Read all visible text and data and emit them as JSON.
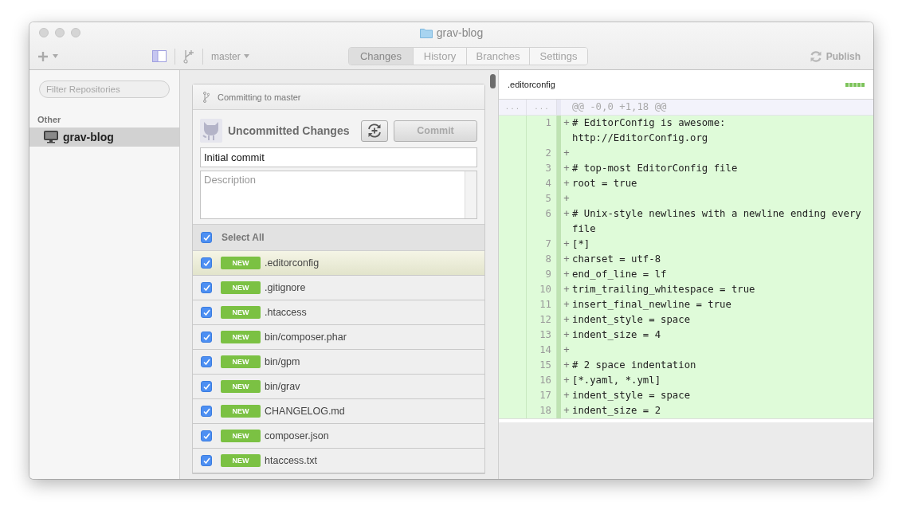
{
  "window": {
    "title": "grav-blog"
  },
  "toolbar": {
    "branch": "master",
    "tabs": [
      {
        "label": "Changes",
        "selected": true
      },
      {
        "label": "History",
        "selected": false
      },
      {
        "label": "Branches",
        "selected": false
      },
      {
        "label": "Settings",
        "selected": false
      }
    ],
    "publish": {
      "label": "Publish",
      "disabled": true
    }
  },
  "sidebar": {
    "filter": {
      "placeholder": "Filter Repositories"
    },
    "sections": [
      {
        "heading": "Other",
        "items": [
          {
            "name": "grav-blog",
            "selected": true
          }
        ]
      }
    ]
  },
  "commit": {
    "branch_label": "Committing to master",
    "title": "Uncommitted Changes",
    "summary": {
      "value": "Initial commit"
    },
    "description": {
      "placeholder": "Description"
    },
    "commit_button": {
      "label": "Commit",
      "disabled": true
    },
    "select_all": {
      "label": "Select All",
      "checked": true
    },
    "files": [
      {
        "name": ".editorconfig",
        "status": "NEW",
        "checked": true,
        "selected": true
      },
      {
        "name": ".gitignore",
        "status": "NEW",
        "checked": true,
        "selected": false
      },
      {
        "name": ".htaccess",
        "status": "NEW",
        "checked": true,
        "selected": false
      },
      {
        "name": "bin/composer.phar",
        "status": "NEW",
        "checked": true,
        "selected": false
      },
      {
        "name": "bin/gpm",
        "status": "NEW",
        "checked": true,
        "selected": false
      },
      {
        "name": "bin/grav",
        "status": "NEW",
        "checked": true,
        "selected": false
      },
      {
        "name": "CHANGELOG.md",
        "status": "NEW",
        "checked": true,
        "selected": false
      },
      {
        "name": "composer.json",
        "status": "NEW",
        "checked": true,
        "selected": false
      },
      {
        "name": "htaccess.txt",
        "status": "NEW",
        "checked": true,
        "selected": false
      }
    ]
  },
  "diff": {
    "file": ".editorconfig",
    "hunk": {
      "old": "...",
      "new": "...",
      "header": "@@ -0,0 +1,18 @@"
    },
    "lines": [
      {
        "number": "1",
        "sign": "+",
        "text": "# EditorConfig is awesome: http://EditorConfig.org"
      },
      {
        "number": "2",
        "sign": "+"
      },
      {
        "number": "3",
        "sign": "+",
        "text": "# top-most EditorConfig file"
      },
      {
        "number": "4",
        "sign": "+",
        "text": "root = true"
      },
      {
        "number": "5",
        "sign": "+"
      },
      {
        "number": "6",
        "sign": "+",
        "text": "# Unix-style newlines with a newline ending every file"
      },
      {
        "number": "7",
        "sign": "+",
        "text": "[*]"
      },
      {
        "number": "8",
        "sign": "+",
        "text": "charset = utf-8"
      },
      {
        "number": "9",
        "sign": "+",
        "text": "end_of_line = lf"
      },
      {
        "number": "10",
        "sign": "+",
        "text": "trim_trailing_whitespace = true"
      },
      {
        "number": "11",
        "sign": "+",
        "text": "insert_final_newline = true"
      },
      {
        "number": "12",
        "sign": "+",
        "text": "indent_style = space"
      },
      {
        "number": "13",
        "sign": "+",
        "text": "indent_size = 4"
      },
      {
        "number": "14",
        "sign": "+"
      },
      {
        "number": "15",
        "sign": "+",
        "text": "# 2 space indentation"
      },
      {
        "number": "16",
        "sign": "+",
        "text": "[*.yaml, *.yml]"
      },
      {
        "number": "17",
        "sign": "+",
        "text": "indent_style = space"
      },
      {
        "number": "18",
        "sign": "+",
        "text": "indent_size = 2"
      }
    ]
  }
}
